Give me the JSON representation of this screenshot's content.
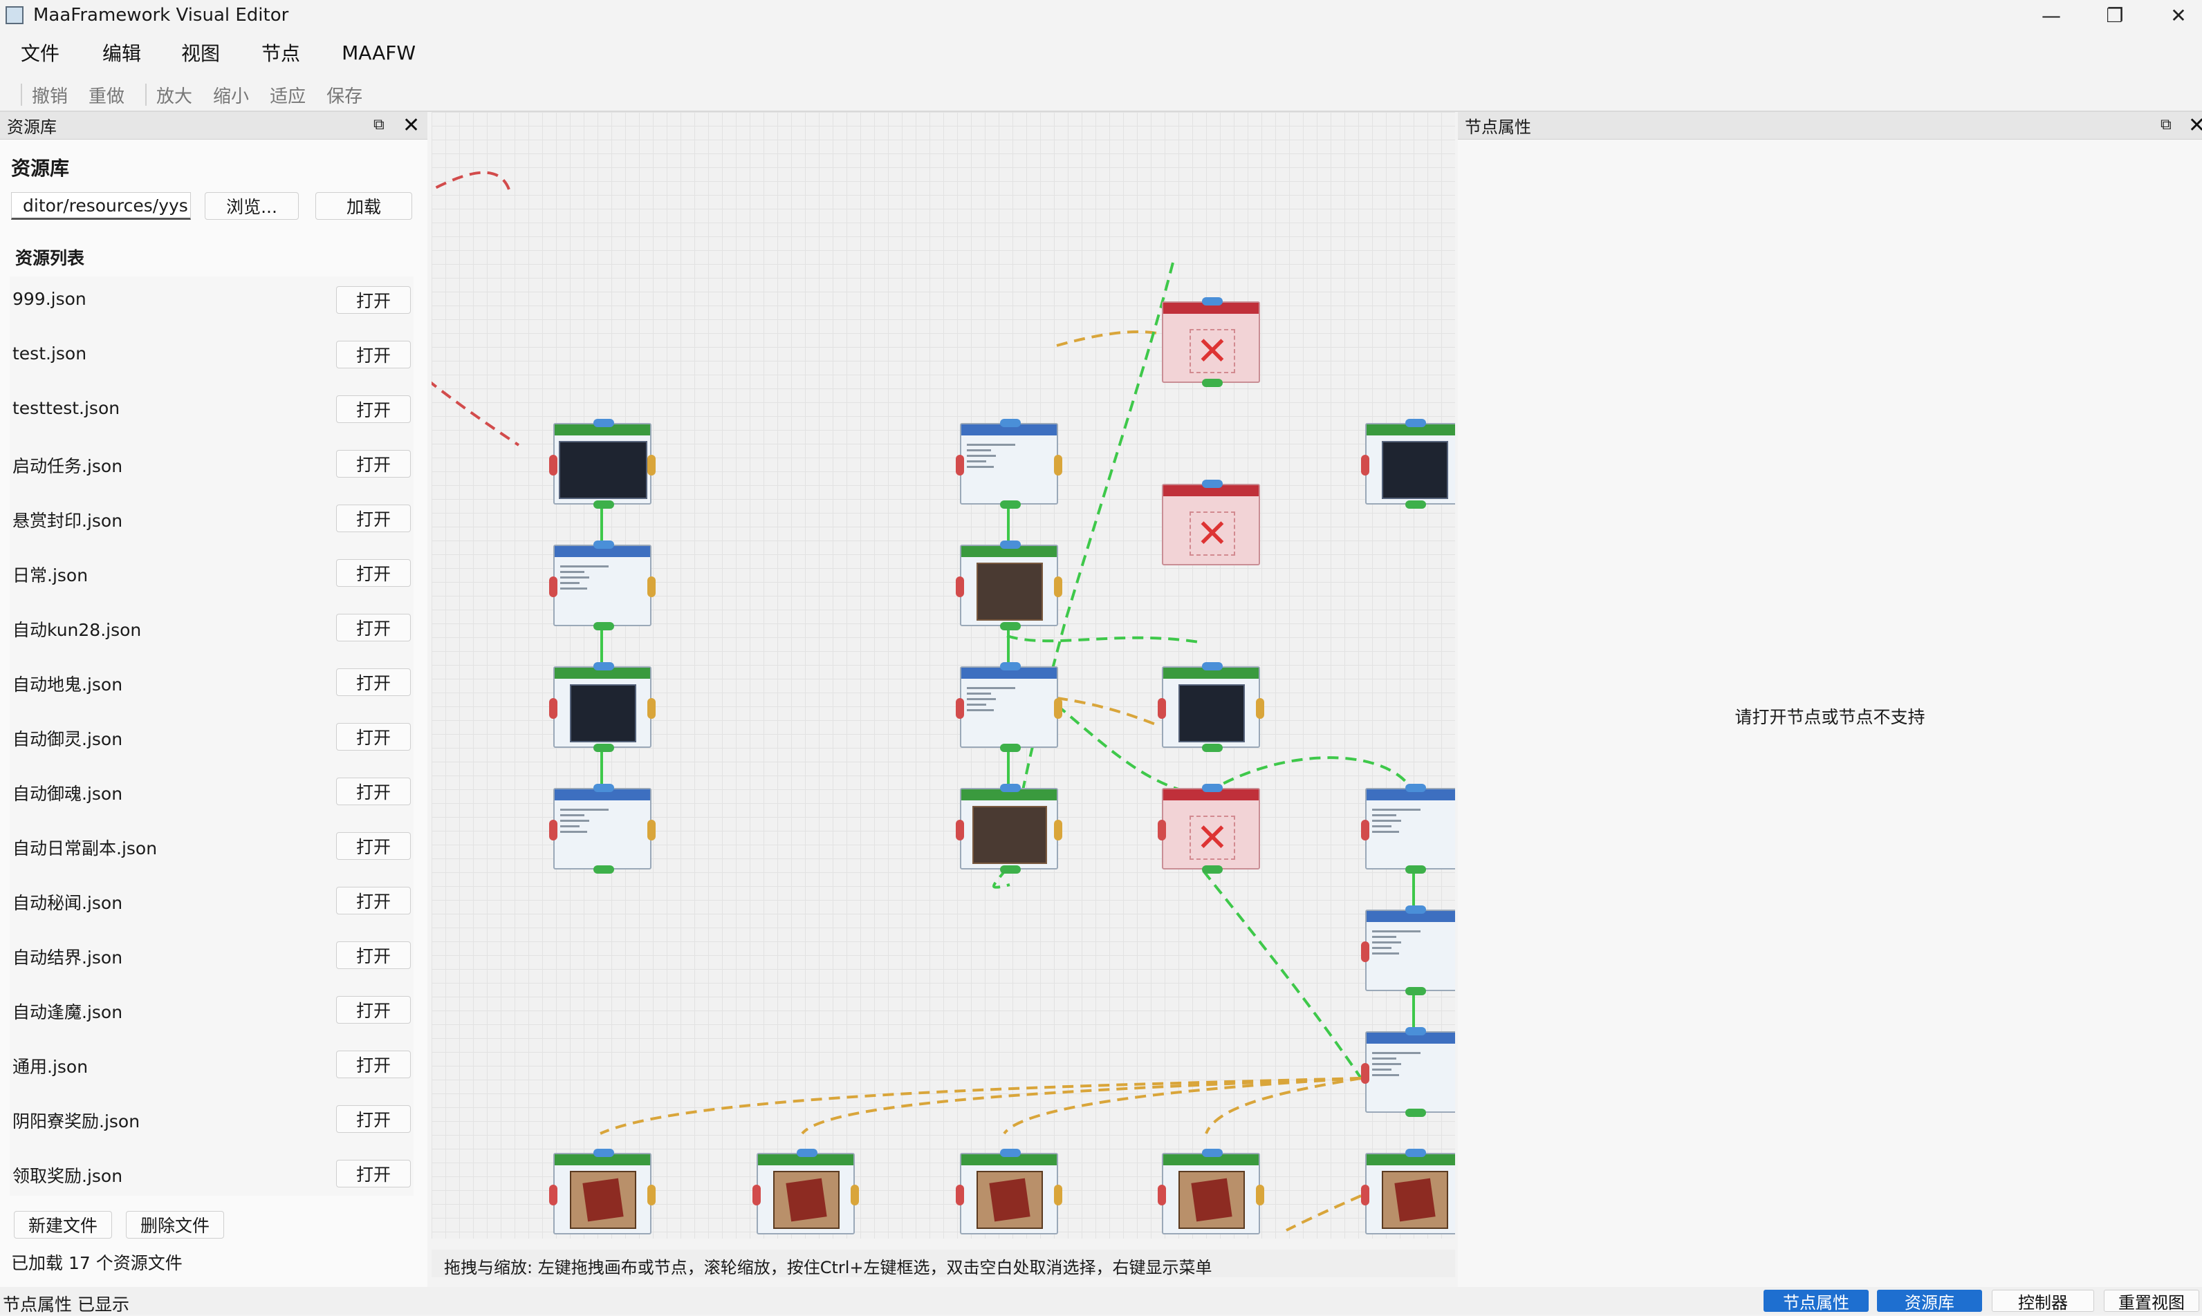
{
  "window": {
    "title": "MaaFramework Visual Editor",
    "minimize": "—",
    "maximize": "❐",
    "close": "✕"
  },
  "menu": [
    "文件",
    "编辑",
    "视图",
    "节点",
    "MAAFW"
  ],
  "toolbar": [
    "撤销",
    "重做",
    "放大",
    "缩小",
    "适应",
    "保存"
  ],
  "left_dock": {
    "title": "资源库",
    "float_icon": "⧉",
    "close_icon": "✕",
    "heading": "资源库",
    "path_value": "ditor/resources/yys",
    "browse_label": "浏览...",
    "load_label": "加载",
    "list_title": "资源列表",
    "open_label": "打开",
    "files": [
      "999.json",
      "test.json",
      "testtest.json",
      "启动任务.json",
      "悬赏封印.json",
      "日常.json",
      "自动kun28.json",
      "自动地鬼.json",
      "自动御灵.json",
      "自动御魂.json",
      "自动日常副本.json",
      "自动秘闻.json",
      "自动结界.json",
      "自动逢魔.json",
      "通用.json",
      "阴阳寮奖励.json",
      "领取奖励.json"
    ],
    "new_file_label": "新建文件",
    "delete_file_label": "删除文件",
    "loaded_text": "已加载 17 个资源文件"
  },
  "canvas": {
    "hint": "拖拽与缩放: 左键拖拽画布或节点，滚轮缩放，按住Ctrl+左键框选，双击空白处取消选择，右键显示菜单"
  },
  "right_dock": {
    "title": "节点属性",
    "float_icon": "⧉",
    "close_icon": "✕",
    "empty_message": "请打开节点或节点不支持"
  },
  "status": {
    "text": "节点属性 已显示",
    "buttons": [
      "节点属性",
      "资源库",
      "控制器",
      "重置视图"
    ]
  },
  "colors": {
    "accent": "#1e6fd0",
    "node_blue": "#3d6fc0",
    "node_green": "#3a9a3e",
    "node_red": "#c0303a",
    "edge_green": "#3ec84a",
    "edge_orange": "#d9a53a",
    "edge_red": "#d24b4b"
  }
}
